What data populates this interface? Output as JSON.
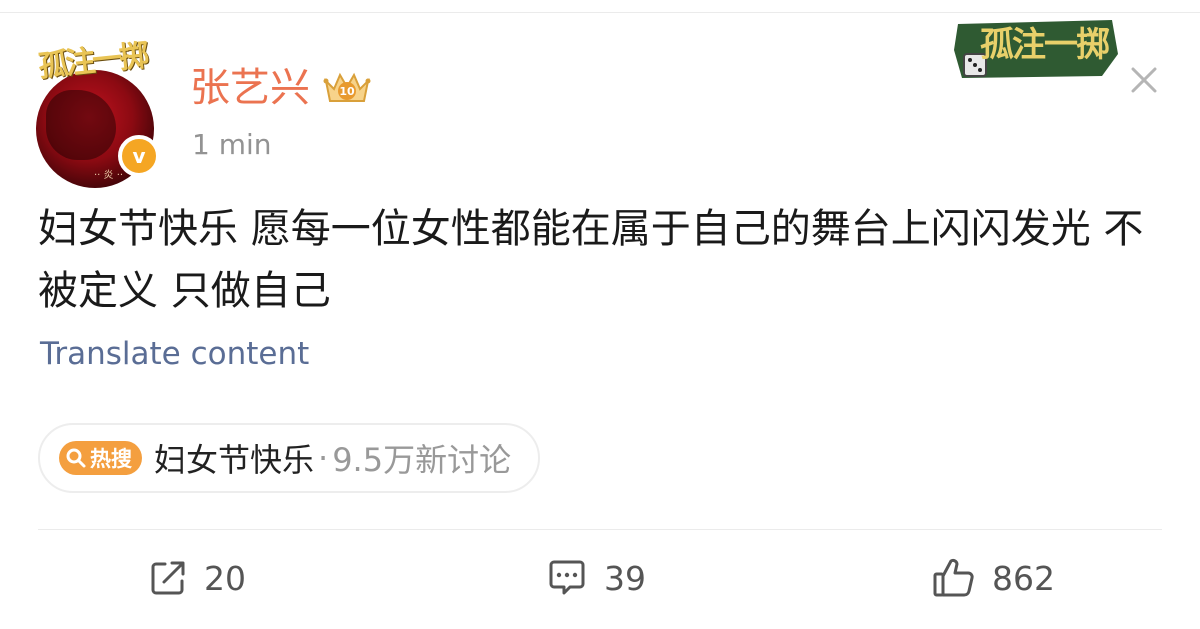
{
  "post": {
    "author": {
      "name": "张艺兴",
      "avatar_logo_text": "孤注一掷",
      "avatar_tiny_text": "·· 炎 ··",
      "verified_mark": "v",
      "vip_level": "10"
    },
    "timestamp": "1 min",
    "text": "妇女节快乐 愿每一位女性都能在属于自己的舞台上闪闪发光 不被定义 只做自己",
    "translate_label": "Translate content",
    "brand_sticker_text": "孤注一掷",
    "hot_topic": {
      "badge_label": "热搜",
      "name": "妇女节快乐",
      "separator": "·",
      "count_text": "9.5万新讨论"
    },
    "actions": {
      "repost_count": "20",
      "comment_count": "39",
      "like_count": "862"
    }
  },
  "icons": {
    "close": "close-icon",
    "repost": "repost-icon",
    "comment": "comment-icon",
    "like": "thumbs-up-icon",
    "search": "search-icon",
    "verified": "verified-badge",
    "vip": "crown-vip-icon"
  },
  "colors": {
    "username": "#eb7350",
    "link": "#5a6d95",
    "hot_badge": "#f49f3f",
    "verified": "#f5a623",
    "muted": "#939393"
  }
}
